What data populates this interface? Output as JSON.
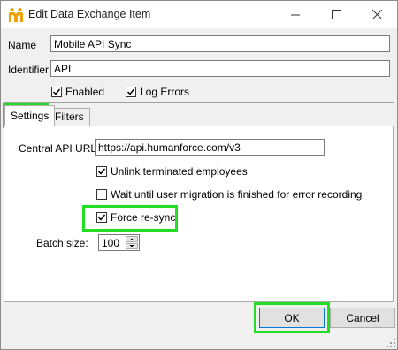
{
  "window": {
    "title": "Edit Data Exchange Item"
  },
  "fields": {
    "name_label": "Name",
    "name_value": "Mobile API Sync",
    "identifier_label": "Identifier",
    "identifier_value": "API"
  },
  "options": {
    "enabled_label": "Enabled",
    "enabled_checked": true,
    "log_errors_label": "Log Errors",
    "log_errors_checked": true
  },
  "tabs": [
    {
      "label": "Settings",
      "active": true
    },
    {
      "label": "Filters",
      "active": false
    }
  ],
  "settings": {
    "central_api_url_label": "Central API URL:",
    "central_api_url_value": "https://api.humanforce.com/v3",
    "unlink_label": "Unlink terminated employees",
    "unlink_checked": true,
    "wait_label": "Wait until user migration is finished for error recording",
    "wait_checked": false,
    "force_resync_label": "Force re-sync",
    "force_resync_checked": true,
    "batch_size_label": "Batch size:",
    "batch_size_value": "100"
  },
  "buttons": {
    "ok_label": "OK",
    "cancel_label": "Cancel"
  },
  "colors": {
    "highlight": "#22dd22",
    "accent": "#0078d7",
    "app_icon": "#f0a000"
  }
}
